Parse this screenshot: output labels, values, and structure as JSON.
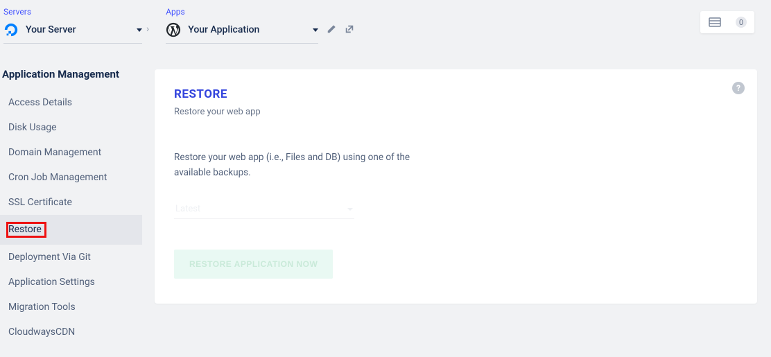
{
  "breadcrumb": {
    "servers_label": "Servers",
    "server_name": "Your Server",
    "apps_label": "Apps",
    "app_name": "Your Application"
  },
  "top_right": {
    "badge_count": "0"
  },
  "sidebar": {
    "title": "Application Management",
    "items": [
      {
        "label": "Access Details"
      },
      {
        "label": "Disk Usage"
      },
      {
        "label": "Domain Management"
      },
      {
        "label": "Cron Job Management"
      },
      {
        "label": "SSL Certificate"
      },
      {
        "label": "Restore",
        "active": true
      },
      {
        "label": "Deployment Via Git"
      },
      {
        "label": "Application Settings"
      },
      {
        "label": "Migration Tools"
      },
      {
        "label": "CloudwaysCDN"
      }
    ]
  },
  "card": {
    "title": "RESTORE",
    "subtitle": "Restore your web app",
    "description": "Restore your web app (i.e., Files and DB) using one of the available backups.",
    "select_value": "Latest",
    "button_label": "RESTORE APPLICATION NOW",
    "help": "?"
  }
}
